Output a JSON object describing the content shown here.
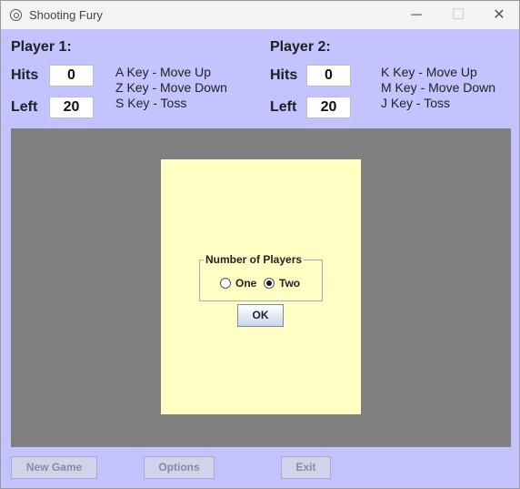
{
  "window": {
    "title": "Shooting Fury",
    "controls": {
      "minimize": "─",
      "maximize": "☐",
      "close": "✕"
    }
  },
  "player1": {
    "title": "Player 1:",
    "hits_label": "Hits",
    "hits_value": "0",
    "left_label": "Left",
    "left_value": "20",
    "keys": [
      "A Key - Move Up",
      "Z Key - Move Down",
      "S Key - Toss"
    ]
  },
  "player2": {
    "title": "Player 2:",
    "hits_label": "Hits",
    "hits_value": "0",
    "left_label": "Left",
    "left_value": "20",
    "keys": [
      "K Key - Move Up",
      "M Key - Move Down",
      "J Key - Toss"
    ]
  },
  "dialog": {
    "group_title": "Number of Players",
    "options": [
      "One",
      "Two"
    ],
    "selected": "Two",
    "ok_label": "OK"
  },
  "buttons": {
    "new_game": "New Game",
    "options": "Options",
    "exit": "Exit"
  },
  "colors": {
    "background": "#c3c3ff",
    "game_area": "#808080",
    "dialog_panel": "#ffffc3"
  }
}
